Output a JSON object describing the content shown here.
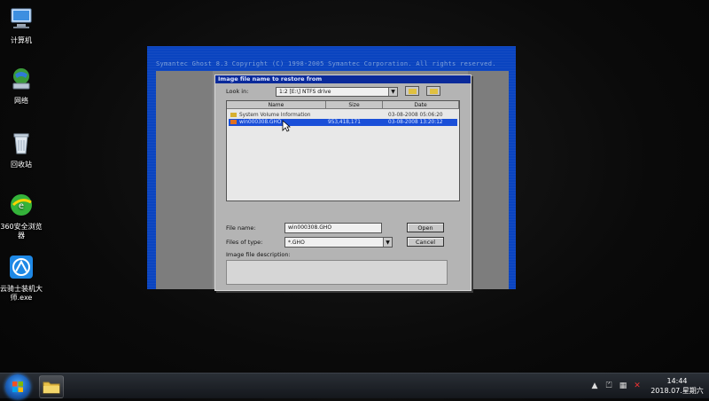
{
  "desktop": {
    "icons": [
      {
        "label": "计算机",
        "icon": "computer-icon"
      },
      {
        "label": "网络",
        "icon": "network-icon"
      },
      {
        "label": "回收站",
        "icon": "recycle-bin-icon"
      },
      {
        "label": "360安全浏览器",
        "icon": "360-browser-icon"
      },
      {
        "label": "云骑士装机大师.exe",
        "icon": "yunqishi-icon"
      }
    ]
  },
  "ghost": {
    "app_title": "Symantec Ghost 8.3   Copyright (C) 1998-2005 Symantec Corporation. All rights reserved.",
    "dialog": {
      "title": "Image file name to restore from",
      "look_in_label": "Look in:",
      "look_in_value": "1:2 [E:\\] NTFS drive",
      "columns": [
        "Name",
        "Size",
        "Date"
      ],
      "rows": [
        {
          "name": "System Volume Information",
          "size": "",
          "date": "03-08-2008 05:06:20",
          "selected": false,
          "type": "folder"
        },
        {
          "name": "win000308.GHO",
          "size": "953,418,171",
          "date": "03-08-2008 13:20:12",
          "selected": true,
          "type": "file"
        }
      ],
      "file_name_label": "File name:",
      "file_name_value": "win000308.GHO",
      "files_of_type_label": "Files of type:",
      "files_of_type_value": "*.GHO",
      "description_label": "Image file description:",
      "open_button": "Open",
      "cancel_button": "Cancel"
    }
  },
  "taskbar": {
    "time": "14:44",
    "date": "2018.07.星期六"
  }
}
